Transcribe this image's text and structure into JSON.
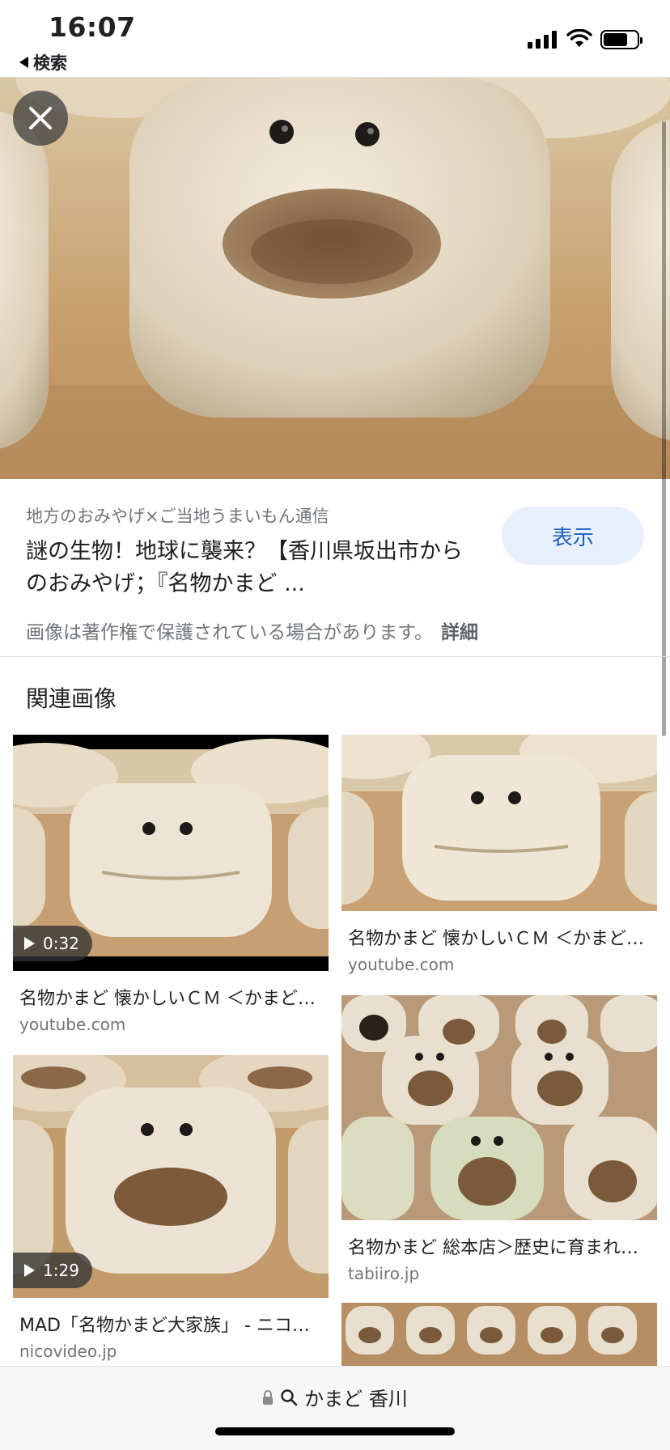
{
  "status_bar": {
    "time": "16:07",
    "back_label": "検索"
  },
  "result": {
    "source": "地方のおみやげ×ご当地うまいもん通信",
    "title": "謎の生物！地球に襲来？【香川県坂出市からのおみやげ；『名物かまど ...",
    "view_button": "表示",
    "copyright_text": "画像は著作権で保護されている場合があります。",
    "details_link": "詳細"
  },
  "related": {
    "heading": "関連画像",
    "items": [
      {
        "title": "名物かまど 懐かしいＣＭ ＜かまど…",
        "domain": "youtube.com",
        "duration": "0:32"
      },
      {
        "title": "名物かまど 懐かしいＣＭ ＜かまど…",
        "domain": "youtube.com"
      },
      {
        "title": "名物かまど 総本店＞歴史に育まれ…",
        "domain": "tabiiro.jp"
      },
      {
        "title": "MAD「名物かまど大家族」 - ニコ…",
        "domain": "nicovideo.jp",
        "duration": "1:29"
      }
    ]
  },
  "url_bar": {
    "text": "かまど 香川"
  }
}
